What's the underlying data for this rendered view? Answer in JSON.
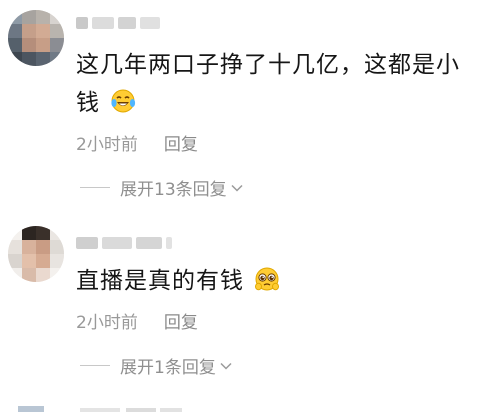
{
  "comments": [
    {
      "text": "这几年两口子挣了十几亿，这都是小钱",
      "emoji": "laughing-tears-emoji",
      "time": "2小时前",
      "reply_label": "回复",
      "expand_label": "展开13条回复"
    },
    {
      "text": "直播是真的有钱",
      "emoji": "pleading-face-emoji",
      "time": "2小时前",
      "reply_label": "回复",
      "expand_label": "展开1条回复"
    }
  ],
  "colors": {
    "text": "#161616",
    "meta": "#999999",
    "divider": "#c8c8c8",
    "background": "#ffffff"
  },
  "icons": {
    "expand": "chevron-down-icon"
  }
}
